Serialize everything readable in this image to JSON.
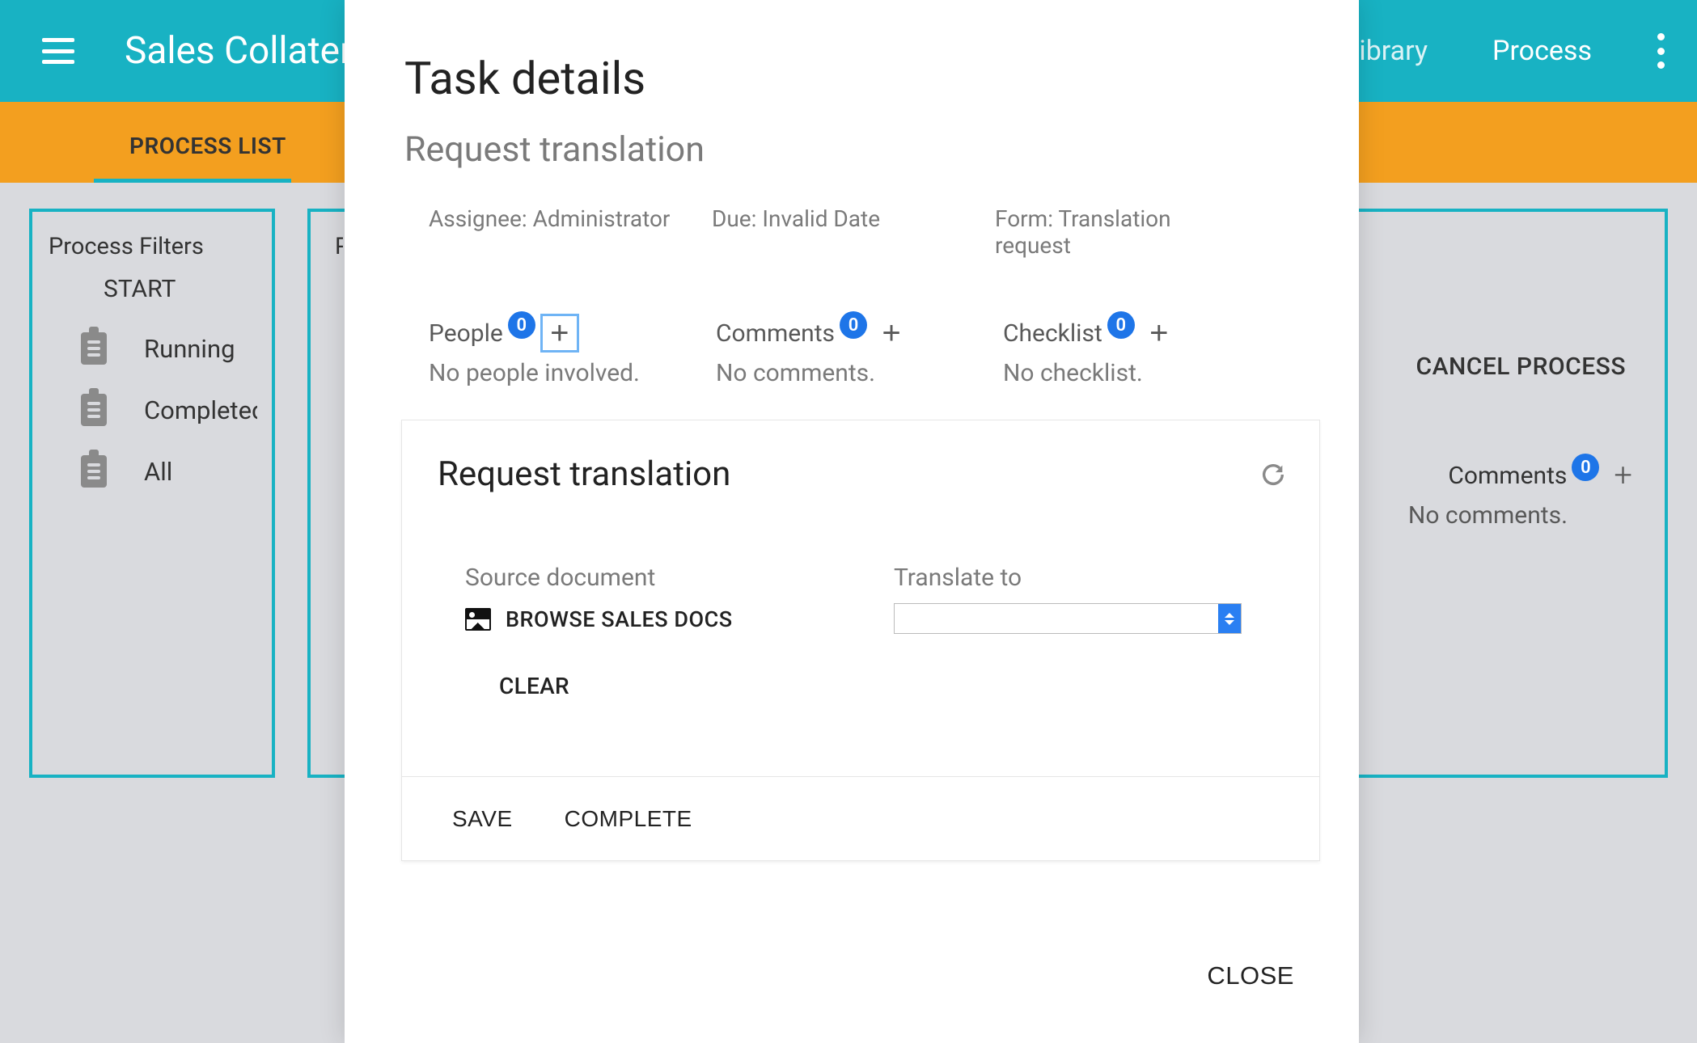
{
  "header": {
    "app_title": "Sales Collateral",
    "nav_items": [
      "Library",
      "Process"
    ]
  },
  "tabs": {
    "active": "PROCESS LIST"
  },
  "left_panel": {
    "title": "Process Filters",
    "sub": "START",
    "items": [
      "Running",
      "Completed",
      "All"
    ]
  },
  "mid_panel": {
    "title": "Processes"
  },
  "right_panel": {
    "cancel": "CANCEL PROCESS",
    "comments_label": "Comments",
    "comments_count": 0,
    "no_comments": "No comments."
  },
  "modal": {
    "title": "Task details",
    "subtitle": "Request translation",
    "meta": {
      "assignee_label": "Assignee:",
      "assignee_value": "Administrator",
      "due_label": "Due:",
      "due_value": "Invalid Date",
      "form_label": "Form:",
      "form_value": "Translation request"
    },
    "sections": {
      "people": {
        "label": "People",
        "count": 0,
        "empty": "No people involved."
      },
      "comments": {
        "label": "Comments",
        "count": 0,
        "empty": "No comments."
      },
      "checklist": {
        "label": "Checklist",
        "count": 0,
        "empty": "No checklist."
      }
    },
    "form": {
      "title": "Request translation",
      "source_label": "Source document",
      "browse_label": "BROWSE SALES DOCS",
      "clear_label": "CLEAR",
      "translate_label": "Translate to",
      "translate_value": "",
      "save": "SAVE",
      "complete": "COMPLETE"
    },
    "close": "CLOSE"
  }
}
